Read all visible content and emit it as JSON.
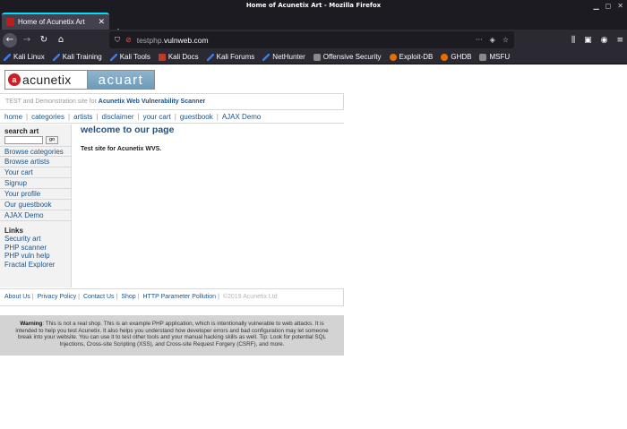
{
  "window": {
    "title": "Home of Acunetix Art - Mozilla Firefox"
  },
  "tab": {
    "title": "Home of Acunetix Art",
    "close": "✕"
  },
  "newtab": "+",
  "urlbar": {
    "host_prefix": "testphp.",
    "host_main": "vulnweb.com"
  },
  "bookmarks": [
    {
      "label": "Kali Linux",
      "icon": "kali-dragon-icon"
    },
    {
      "label": "Kali Training",
      "icon": "kali-dragon-icon"
    },
    {
      "label": "Kali Tools",
      "icon": "kali-dragon-icon"
    },
    {
      "label": "Kali Docs",
      "icon": "docs-icon"
    },
    {
      "label": "Kali Forums",
      "icon": "kali-dragon-icon"
    },
    {
      "label": "NetHunter",
      "icon": "kali-dragon-icon"
    },
    {
      "label": "Offensive Security",
      "icon": "offsec-icon"
    },
    {
      "label": "Exploit-DB",
      "icon": "exploitdb-icon"
    },
    {
      "label": "GHDB",
      "icon": "exploitdb-icon"
    },
    {
      "label": "MSFU",
      "icon": "offsec-icon"
    }
  ],
  "site": {
    "logo_left": "acunetix",
    "logo_right": "acuart",
    "tagline_prefix": "TEST and Demonstration site for",
    "tagline_link": "Acunetix Web Vulnerability Scanner",
    "menu": [
      "home",
      "categories",
      "artists",
      "disclaimer",
      "your cart",
      "guestbook",
      "AJAX Demo"
    ],
    "search_title": "search art",
    "search_button": "go",
    "search_value": "",
    "sidebar_links": [
      "Browse categories",
      "Browse artists",
      "Your cart",
      "Signup",
      "Your profile",
      "Our guestbook",
      "AJAX Demo"
    ],
    "links_title": "Links",
    "external_links": [
      "Security art",
      "PHP scanner",
      "PHP vuln help",
      "Fractal Explorer"
    ],
    "main_title": "welcome to our page",
    "main_subtitle": "Test site for Acunetix WVS.",
    "footer_links": [
      "About Us",
      "Privacy Policy",
      "Contact Us",
      "Shop",
      "HTTP Parameter Pollution"
    ],
    "copyright": "©2019 Acunetix Ltd",
    "warning_label": "Warning",
    "warning_text": ": This is not a real shop. This is an example PHP application, which is intentionally vulnerable to web attacks. It is intended to help you test Acunetix. It also helps you understand how developer errors and bad configuration may let someone break into your website. You can use it to test other tools and your manual hacking skills as well. Tip: Look for potential SQL Injections, Cross-site Scripting (XSS), and Cross-site Request Forgery (CSRF), and more."
  },
  "colors": {
    "chrome_dark": "#1c1b22",
    "chrome_toolbar": "#2b2a33",
    "tab_accent": "#00ddff",
    "link_blue": "#1d5387",
    "logo_red": "#cc1f26"
  }
}
